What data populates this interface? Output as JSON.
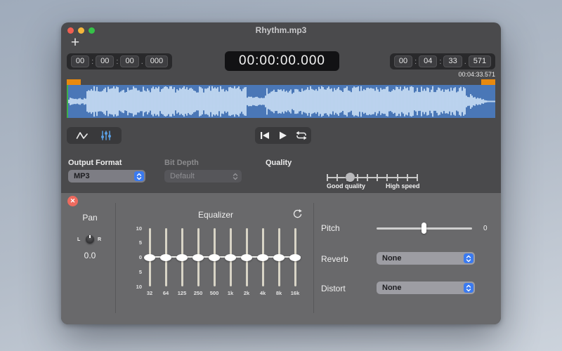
{
  "titlebar": {
    "title": "Rhythm.mp3"
  },
  "toolbar": {
    "add_label": "+"
  },
  "times": {
    "start": {
      "h": "00",
      "m": "00",
      "s": "00",
      "ms": "000"
    },
    "main": "00:00:00.000",
    "end": {
      "h": "00",
      "m": "04",
      "s": "33",
      "ms": "571"
    },
    "duration": "00:04:33.571"
  },
  "format": {
    "output_label": "Output Format",
    "output_value": "MP3",
    "bitdepth_label": "Bit Depth",
    "bitdepth_value": "Default",
    "quality_label": "Quality",
    "quality_left": "Good quality",
    "quality_right": "High speed",
    "quality_position": 0.26,
    "quality_ticks": 10
  },
  "effects": {
    "pan": {
      "label": "Pan",
      "left": "L",
      "right": "R",
      "value": "0.0"
    },
    "equalizer": {
      "title": "Equalizer",
      "scale": [
        "10",
        "5",
        "0",
        "5",
        "10"
      ],
      "bands": [
        "32",
        "64",
        "125",
        "250",
        "500",
        "1k",
        "2k",
        "4k",
        "8k",
        "16k"
      ],
      "values": [
        0,
        0,
        0,
        0,
        0,
        0,
        0,
        0,
        0,
        0
      ]
    },
    "pitch": {
      "label": "Pitch",
      "value": "0"
    },
    "reverb": {
      "label": "Reverb",
      "value": "None"
    },
    "distort": {
      "label": "Distort",
      "value": "None"
    }
  },
  "colors": {
    "accent_blue": "#3a7af0",
    "marker_orange": "#e8890f",
    "wave_background": "#4a77b7",
    "wave_foreground": "#cfe3f7",
    "playhead_green": "#3fae4a"
  }
}
